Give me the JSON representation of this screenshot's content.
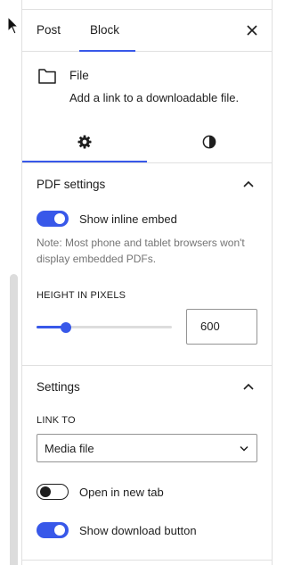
{
  "sidebar": {
    "tabs": [
      {
        "label": "Post"
      },
      {
        "label": "Block"
      }
    ],
    "active_tab": "Block",
    "close_icon": "close-icon"
  },
  "block_card": {
    "icon": "file-icon",
    "title": "File",
    "description": "Add a link to a downloadable file."
  },
  "inspector_tabs": [
    {
      "icon": "gear-icon",
      "active": true
    },
    {
      "icon": "contrast-icon",
      "active": false
    }
  ],
  "pdf_settings": {
    "title": "PDF settings",
    "expanded": true,
    "show_inline_embed": {
      "label": "Show inline embed",
      "checked": true
    },
    "note": "Note: Most phone and tablet browsers won't display embedded PDFs.",
    "height_label": "HEIGHT IN PIXELS",
    "height_value": "600",
    "slider_fraction": 0.22
  },
  "settings": {
    "title": "Settings",
    "expanded": true,
    "link_to_label": "LINK TO",
    "link_to_value": "Media file",
    "open_in_new_tab": {
      "label": "Open in new tab",
      "checked": false
    },
    "show_download_button": {
      "label": "Show download button",
      "checked": true
    }
  },
  "colors": {
    "accent": "#3858e9",
    "text": "#1e1e1e",
    "muted": "#757575",
    "border": "#e0e0e0"
  }
}
